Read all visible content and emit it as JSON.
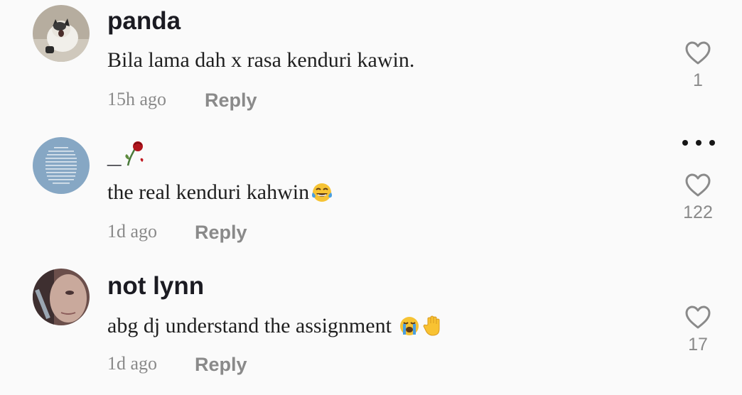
{
  "comments": [
    {
      "username": "panda",
      "text": "Bila lama dah x rasa kenduri kawin.",
      "time": "15h ago",
      "reply_label": "Reply",
      "likes": "1",
      "avatar_icon": "cat-photo-avatar"
    },
    {
      "username": "_",
      "username_emoji": "wilted-rose-icon",
      "text": "the real kenduri kahwin",
      "text_emoji": "face-with-tears-of-joy-icon",
      "time": "1d ago",
      "reply_label": "Reply",
      "likes": "122",
      "avatar_icon": "text-quote-avatar"
    },
    {
      "username": "not lynn",
      "text": "abg dj understand the assignment ",
      "text_emojis": [
        "loudly-crying-face-icon",
        "raised-hand-icon"
      ],
      "time": "1d ago",
      "reply_label": "Reply",
      "likes": "17",
      "avatar_icon": "selfie-photo-avatar"
    }
  ],
  "more_options_icon": "more-options-icon",
  "colors": {
    "background": "#fafafa",
    "username": "#1b1b22",
    "secondary": "#8a8a8a",
    "text": "#1f1f1f"
  }
}
